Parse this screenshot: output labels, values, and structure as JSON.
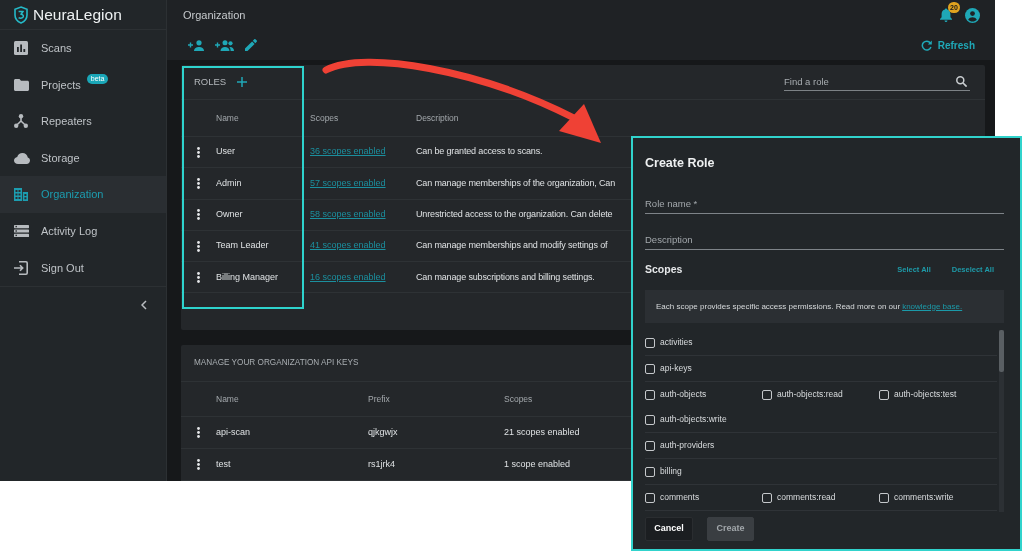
{
  "sidebar": {
    "logo": "NeuraLegion",
    "items": [
      {
        "label": "Scans",
        "selected": false
      },
      {
        "label": "Projects",
        "selected": false,
        "badge": "beta"
      },
      {
        "label": "Repeaters",
        "selected": false
      },
      {
        "label": "Storage",
        "selected": false
      },
      {
        "label": "Organization",
        "selected": true
      },
      {
        "label": "Activity Log",
        "selected": false
      },
      {
        "label": "Sign Out",
        "selected": false
      }
    ]
  },
  "header": {
    "title": "Organization",
    "notification_count": "20"
  },
  "toolbar": {
    "refresh": "Refresh"
  },
  "roles": {
    "title": "ROLES",
    "search": {
      "placeholder": "Find a role"
    },
    "columns": [
      "Name",
      "Scopes",
      "Description"
    ],
    "rows": [
      {
        "name": "User",
        "scopes": "36 scopes enabled",
        "description": "Can be granted access to scans."
      },
      {
        "name": "Admin",
        "scopes": "57 scopes enabled",
        "description": "Can manage memberships of the organization, Can"
      },
      {
        "name": "Owner",
        "scopes": "58 scopes enabled",
        "description": "Unrestricted access to the organization. Can delete"
      },
      {
        "name": "Team Leader",
        "scopes": "41 scopes enabled",
        "description": "Can manage memberships and modify settings of"
      },
      {
        "name": "Billing Manager",
        "scopes": "16 scopes enabled",
        "description": "Can manage subscriptions and billing settings."
      }
    ]
  },
  "api_keys": {
    "title": "MANAGE YOUR ORGANIZATION API KEYS",
    "columns": [
      "Name",
      "Prefix",
      "Scopes"
    ],
    "rows": [
      {
        "name": "api-scan",
        "prefix": "qjkgwjx",
        "scopes": "21 scopes enabled"
      },
      {
        "name": "test",
        "prefix": "rs1jrk4",
        "scopes": "1 scope enabled"
      }
    ]
  },
  "dialog": {
    "title": "Create Role",
    "fields": [
      {
        "placeholder": "Role name *"
      },
      {
        "placeholder": "Description"
      }
    ],
    "scopes_title": "Scopes",
    "scope_actions": [
      "Select All",
      "Deselect All"
    ],
    "info": {
      "text": "Each scope provides specific access permissions. Read more on our",
      "link": "knowledge base."
    },
    "scope_groups": [
      {
        "items": [
          {
            "label": "activities",
            "checked": false
          }
        ]
      },
      {
        "items": [
          {
            "label": "api-keys",
            "checked": false
          }
        ]
      },
      {
        "items": [
          {
            "label": "auth-objects",
            "checked": false
          },
          {
            "label": "auth-objects:read",
            "checked": false
          },
          {
            "label": "auth-objects:test",
            "checked": false
          },
          {
            "label": "auth-objects:write",
            "checked": false
          }
        ]
      },
      {
        "items": [
          {
            "label": "auth-providers",
            "checked": false
          }
        ]
      },
      {
        "items": [
          {
            "label": "billing",
            "checked": false
          }
        ]
      },
      {
        "items": [
          {
            "label": "comments",
            "checked": false
          },
          {
            "label": "comments:read",
            "checked": false
          },
          {
            "label": "comments:write",
            "checked": false
          }
        ]
      }
    ],
    "buttons": [
      {
        "label": "Cancel",
        "disabled": false
      },
      {
        "label": "Create",
        "disabled": true
      }
    ]
  },
  "annotations": {
    "highlight_frame": true,
    "arrow": true
  }
}
